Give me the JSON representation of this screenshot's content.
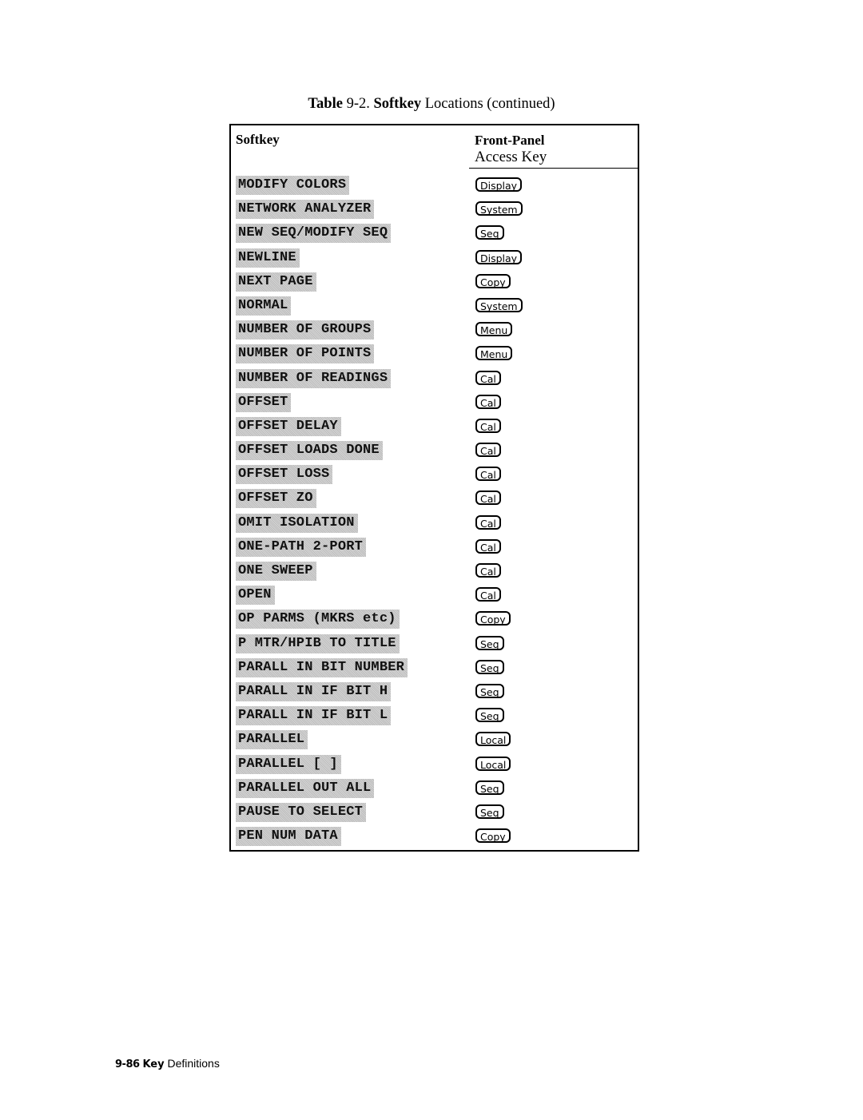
{
  "caption": {
    "table_word": "Table",
    "table_number": "9-2.",
    "softkey_word": "Softkey",
    "rest": "Locations (continued)"
  },
  "table": {
    "headers": {
      "softkey": "Softkey",
      "access_bold": "Front-Panel",
      "access_rest": "Access Key"
    },
    "rows": [
      {
        "softkey": "MODIFY COLORS",
        "key": "Display"
      },
      {
        "softkey": "NETWORK ANALYZER",
        "key": "System"
      },
      {
        "softkey": "NEW SEQ/MODIFY SEQ",
        "key": "Seq"
      },
      {
        "softkey": "NEWLINE",
        "key": "Display"
      },
      {
        "softkey": "NEXT PAGE",
        "key": "Copy"
      },
      {
        "softkey": "NORMAL",
        "key": "System"
      },
      {
        "softkey": "NUMBER OF GROUPS",
        "key": "Menu"
      },
      {
        "softkey": "NUMBER OF POINTS",
        "key": "Menu"
      },
      {
        "softkey": "NUMBER OF READINGS",
        "key": "Cal"
      },
      {
        "softkey": "OFFSET",
        "key": "Cal"
      },
      {
        "softkey": "OFFSET DELAY",
        "key": "Cal"
      },
      {
        "softkey": "OFFSET LOADS DONE",
        "key": "Cal"
      },
      {
        "softkey": "OFFSET LOSS",
        "key": "Cal"
      },
      {
        "softkey": "OFFSET ZO",
        "key": "Cal"
      },
      {
        "softkey": "OMIT ISOLATION",
        "key": "Cal"
      },
      {
        "softkey": "ONE-PATH 2-PORT",
        "key": "Cal"
      },
      {
        "softkey": "ONE SWEEP",
        "key": "Cal"
      },
      {
        "softkey": "OPEN",
        "key": "Cal"
      },
      {
        "softkey": "OP PARMS (MKRS etc)",
        "key": "Copy"
      },
      {
        "softkey": "P MTR/HPIB TO TITLE",
        "key": "Seq"
      },
      {
        "softkey": "PARALL IN BIT NUMBER",
        "key": "Seq"
      },
      {
        "softkey": "PARALL IN IF BIT H",
        "key": "Seq"
      },
      {
        "softkey": "PARALL IN IF BIT L",
        "key": "Seq"
      },
      {
        "softkey": "PARALLEL",
        "key": "Local"
      },
      {
        "softkey": "PARALLEL [ ]",
        "key": "Local"
      },
      {
        "softkey": "PARALLEL OUT ALL",
        "key": "Seq"
      },
      {
        "softkey": "PAUSE TO SELECT",
        "key": "Seq"
      },
      {
        "softkey": "PEN NUM DATA",
        "key": "Copy"
      }
    ]
  },
  "footer": {
    "page": "9-86",
    "key_word": "Key",
    "section": "Definitions"
  }
}
